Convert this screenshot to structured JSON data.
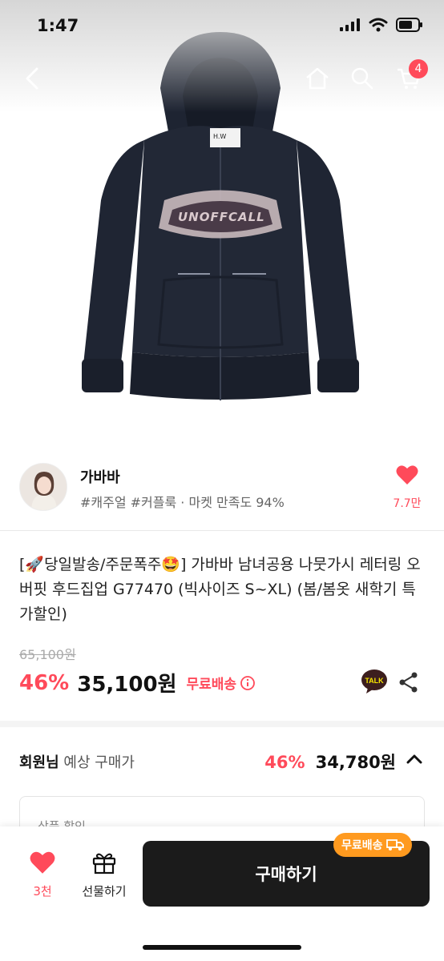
{
  "status": {
    "time": "1:47"
  },
  "nav": {
    "cart_count": "4"
  },
  "product": {
    "brand_label": "H.W",
    "graphic_text": "UNOFFCALL"
  },
  "shop": {
    "name": "가바바",
    "tags": "#캐주얼 #커플룩 · 마켓 만족도 94%",
    "likes": "7.7만"
  },
  "title": "[🚀당일발송/주문폭주🤩] 가바바 남녀공용 나뭇가시 레터링 오버핏 후드집업 G77470 (빅사이즈 S~XL) (봄/봄옷 새학기 특가할인)",
  "price": {
    "original": "65,100원",
    "discount": "46%",
    "sale": "35,100원",
    "free_shipping": "무료배송"
  },
  "member": {
    "label_bold": "회원님",
    "label_rest": " 예상 구매가",
    "discount": "46%",
    "price": "34,780원"
  },
  "coupon": {
    "label": "상품 할인"
  },
  "bottom": {
    "wish_count": "3천",
    "gift_label": "선물하기",
    "buy_label": "구매하기",
    "ship_pill": "무료배송"
  },
  "colors": {
    "accent": "#ff4a5a",
    "ship_pill": "#ff9a1f",
    "buy_button": "#1b1b1b"
  }
}
